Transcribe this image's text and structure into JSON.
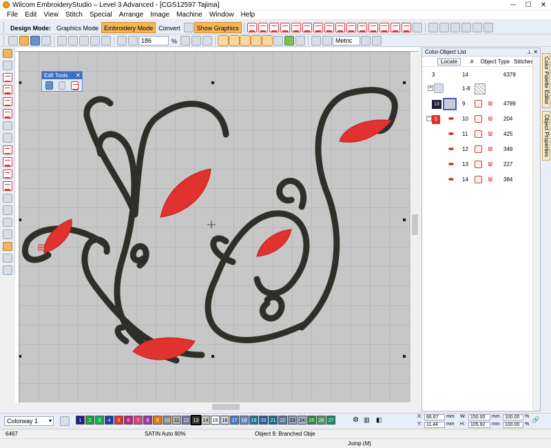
{
  "window": {
    "title": "Wilcom EmbroideryStudio – Level 3 Advanced - [CGS12597        Tajima]"
  },
  "menu": [
    "File",
    "Edit",
    "View",
    "Stitch",
    "Special",
    "Arrange",
    "Image",
    "Machine",
    "Window",
    "Help"
  ],
  "toolbar": {
    "design_mode_label": "Design Mode:",
    "graphics_mode": "Graphics Mode",
    "embroidery_mode": "Embroidery Mode",
    "convert": "Convert",
    "show_graphics": "Show Graphics",
    "zoom_value": "186",
    "zoom_unit": "%",
    "units": "Metric"
  },
  "edit_tools": {
    "title": "Edit Tools"
  },
  "color_object_list": {
    "title": "Color-Object List",
    "locate": "Locate",
    "col_num": "#",
    "col_type": "Object Type",
    "col_stitches": "Stitches",
    "summary": {
      "count": "3",
      "num": "14",
      "stitches": "6378"
    },
    "rows": [
      {
        "num": "1-8",
        "stitches": "",
        "badge": ""
      },
      {
        "num": "9",
        "stitches": "4789",
        "badge": "13"
      },
      {
        "num": "10",
        "stitches": "204",
        "badge": "5"
      },
      {
        "num": "11",
        "stitches": "425",
        "badge": ""
      },
      {
        "num": "12",
        "stitches": "349",
        "badge": ""
      },
      {
        "num": "13",
        "stitches": "227",
        "badge": ""
      },
      {
        "num": "14",
        "stitches": "384",
        "badge": ""
      }
    ]
  },
  "side_tabs": [
    "Color Palette Editor",
    "Object Properties"
  ],
  "colorway": "Colorway 1",
  "palette": [
    {
      "n": "1",
      "c": "#1d1d8a"
    },
    {
      "n": "2",
      "c": "#1aa23a"
    },
    {
      "n": "3",
      "c": "#10b050"
    },
    {
      "n": "4",
      "c": "#1a3ab0"
    },
    {
      "n": "5",
      "c": "#e0322f"
    },
    {
      "n": "6",
      "c": "#c02080"
    },
    {
      "n": "7",
      "c": "#e04080"
    },
    {
      "n": "8",
      "c": "#a03aa0"
    },
    {
      "n": "9",
      "c": "#e07a10"
    },
    {
      "n": "10",
      "c": "#8a8a8a"
    },
    {
      "n": "11",
      "c": "#b0b0b0"
    },
    {
      "n": "12",
      "c": "#7a7aa0"
    },
    {
      "n": "13",
      "c": "#3a3a38"
    },
    {
      "n": "14",
      "c": "#c8c8c8"
    },
    {
      "n": "15",
      "c": "#ffffff"
    },
    {
      "n": "16",
      "c": "#c8d4e8"
    },
    {
      "n": "17",
      "c": "#4a7ac0"
    },
    {
      "n": "18",
      "c": "#6a8acc"
    },
    {
      "n": "19",
      "c": "#1a7a9a"
    },
    {
      "n": "20",
      "c": "#2a5aa0"
    },
    {
      "n": "21",
      "c": "#1a6a8a"
    },
    {
      "n": "22",
      "c": "#5a7aa0"
    },
    {
      "n": "23",
      "c": "#8aa0c0"
    },
    {
      "n": "24",
      "c": "#a0b0d0"
    },
    {
      "n": "25",
      "c": "#2a8a4a"
    },
    {
      "n": "26",
      "c": "#4a9a6a"
    },
    {
      "n": "27",
      "c": "#1a8a6a"
    }
  ],
  "coords": {
    "x": "66.67",
    "y": "11.44",
    "w": "150.00",
    "h": "105.92",
    "sx": "100.00",
    "sy": "100.00",
    "unit": "mm",
    "pct": "%"
  },
  "status": {
    "stitch_count": "6467",
    "stitch_type": "SATIN Auto 90%",
    "object": "Object 9: Branched Obje",
    "command": "Jump (M)"
  },
  "colors": {
    "thread_dark": "#2f2f2a",
    "thread_red": "#e0322f",
    "accent": "#f6b658"
  }
}
